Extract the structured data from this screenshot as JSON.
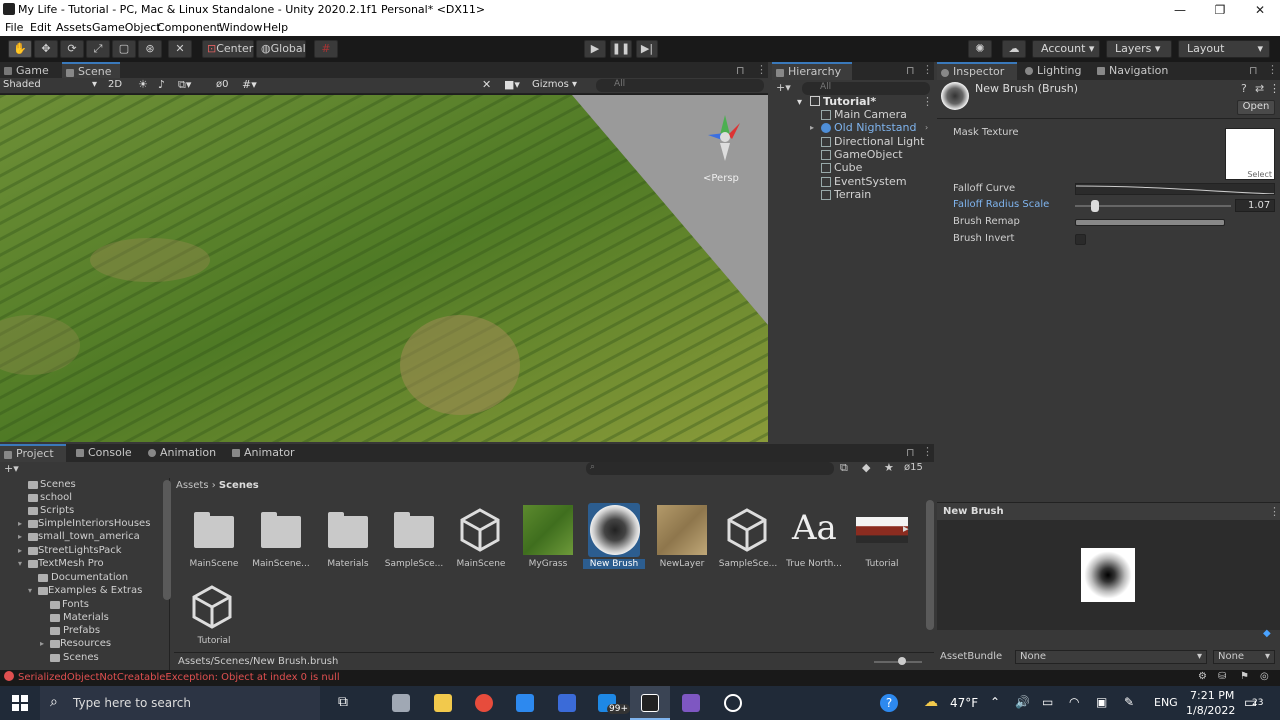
{
  "window": {
    "title": "My Life - Tutorial - PC, Mac & Linux Standalone - Unity 2020.2.1f1 Personal* <DX11>",
    "min": "—",
    "max": "❐",
    "close": "✕"
  },
  "menu": [
    "File",
    "Edit",
    "Assets",
    "GameObject",
    "Component",
    "Window",
    "Help"
  ],
  "toolbar": {
    "center": "Center",
    "global": "Global",
    "account": "Account",
    "layers": "Layers",
    "layout": "Layout"
  },
  "scene": {
    "tab_game": "Game",
    "tab_scene": "Scene",
    "shading": "Shaded",
    "mode2d": "2D",
    "gizmos": "Gizmos",
    "search_placeholder": "All",
    "persp": "<Persp",
    "hidden_count": "0"
  },
  "hierarchy": {
    "tab": "Hierarchy",
    "search_placeholder": "All",
    "root": "Tutorial*",
    "items": [
      "Main Camera",
      "Old Nightstand",
      "Directional Light",
      "GameObject",
      "Cube",
      "EventSystem",
      "Terrain"
    ]
  },
  "inspector": {
    "tab_inspector": "Inspector",
    "tab_lighting": "Lighting",
    "tab_navigation": "Navigation",
    "asset_name": "New Brush (Brush)",
    "open": "Open",
    "mask_texture": "Mask Texture",
    "select": "Select",
    "falloff_curve": "Falloff Curve",
    "falloff_radius": "Falloff Radius Scale",
    "falloff_value": "1.07",
    "falloff_level": 0.1,
    "brush_remap": "Brush Remap",
    "brush_invert": "Brush Invert",
    "preview_title": "New Brush",
    "assetbundle_label": "AssetBundle",
    "assetbundle_value": "None",
    "variant_value": "None"
  },
  "project": {
    "tab_project": "Project",
    "tab_console": "Console",
    "tab_animation": "Animation",
    "tab_animator": "Animator",
    "count": "15",
    "breadcrumb_root": "Assets",
    "breadcrumb_current": "Scenes",
    "path": "Assets/Scenes/New Brush.brush",
    "tree": [
      "Scenes",
      "school",
      "Scripts",
      "SimpleInteriorsHouses",
      "small_town_america",
      "StreetLightsPack",
      "TextMesh Pro",
      "Documentation",
      "Examples & Extras",
      "Fonts",
      "Materials",
      "Prefabs",
      "Resources",
      "Scenes"
    ],
    "assets": [
      "MainScene",
      "MainScene...",
      "Materials",
      "SampleSce...",
      "MainScene",
      "MyGrass",
      "New Brush",
      "NewLayer",
      "SampleSce...",
      "True North...",
      "Tutorial",
      "Tutorial"
    ],
    "true_north_glyph": "Aa"
  },
  "status": {
    "error": "SerializedObjectNotCreatableException: Object at index 0 is null"
  },
  "taskbar": {
    "search": "Type here to search",
    "badge": "99+",
    "weather": "47°F",
    "lang": "ENG",
    "time": "7:21 PM",
    "date": "1/8/2022",
    "notif": "23"
  }
}
